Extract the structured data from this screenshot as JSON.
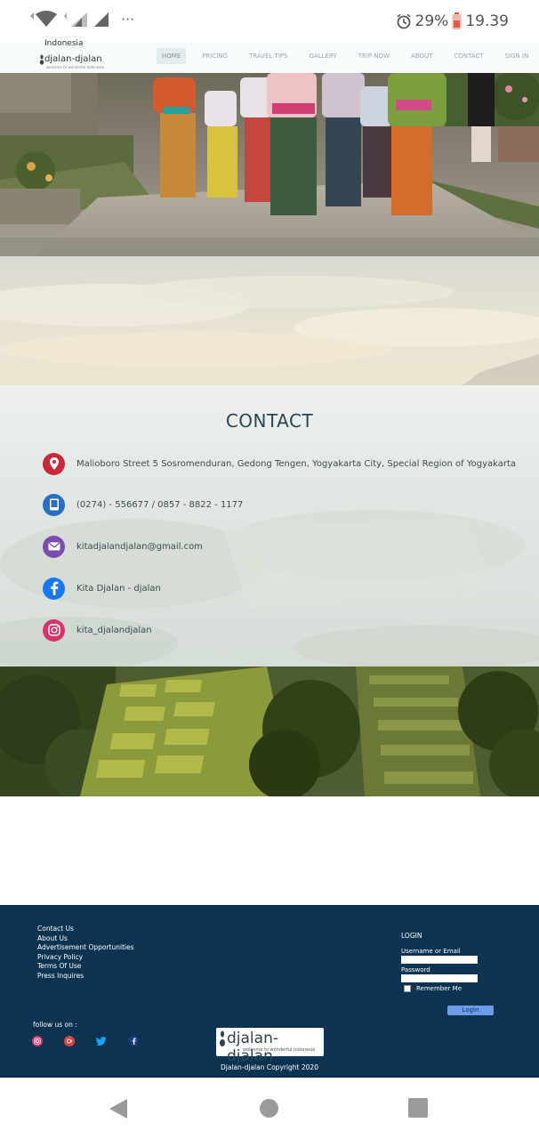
{
  "status_bar": {
    "alarm_icon": "alarm-clock-icon",
    "battery_percent": "29%",
    "time": "19.39",
    "overflow": "···"
  },
  "navbar": {
    "brand_top": "Indonesia",
    "brand_name": "djalan-djalan",
    "brand_tagline": "welcome to wonderful Indonesia",
    "links": [
      "HOME",
      "PRICING",
      "TRAVEL TIPS",
      "GALLERY",
      "TRIP NOW",
      "ABOUT",
      "CONTACT",
      "SIGN IN"
    ],
    "active_link": "HOME"
  },
  "contact": {
    "title": "CONTACT",
    "items": [
      {
        "icon": "location-pin-icon",
        "text": "Malioboro Street 5 Sosromenduran, Gedong Tengen, Yogyakarta City, Special Region of Yogyakarta",
        "color": "#c9283b"
      },
      {
        "icon": "phone-icon",
        "text": "(0274) - 556677 / 0857 - 8822 - 1177",
        "color": "#2a6fc4"
      },
      {
        "icon": "mail-icon",
        "text": "kitadjalandjalan@gmail.com",
        "color": "#7a4cab"
      },
      {
        "icon": "facebook-icon",
        "text": "Kita Djalan - djalan",
        "color": "#1877f2"
      },
      {
        "icon": "instagram-icon",
        "text": "kita_djalandjalan",
        "color": "#d6336c"
      }
    ]
  },
  "footer": {
    "links": [
      "Contact Us",
      "About Us",
      "Advertisement Opportunities",
      "Privacy Policy",
      "Terms Of Use",
      "Press Inquires"
    ],
    "follow_label": "follow us on :",
    "logo_name": "djalan-djalan",
    "logo_tagline": "welcome to wonderful Indonesia",
    "copyright": "Djalan-djalan Copyright 2020",
    "login": {
      "title": "LOGIN",
      "username_label": "Username or Email",
      "password_label": "Password",
      "remember_label": "Remember Me",
      "button_label": "Login"
    },
    "colors": {
      "background": "#0c3352",
      "button": "#6e9be8"
    }
  }
}
